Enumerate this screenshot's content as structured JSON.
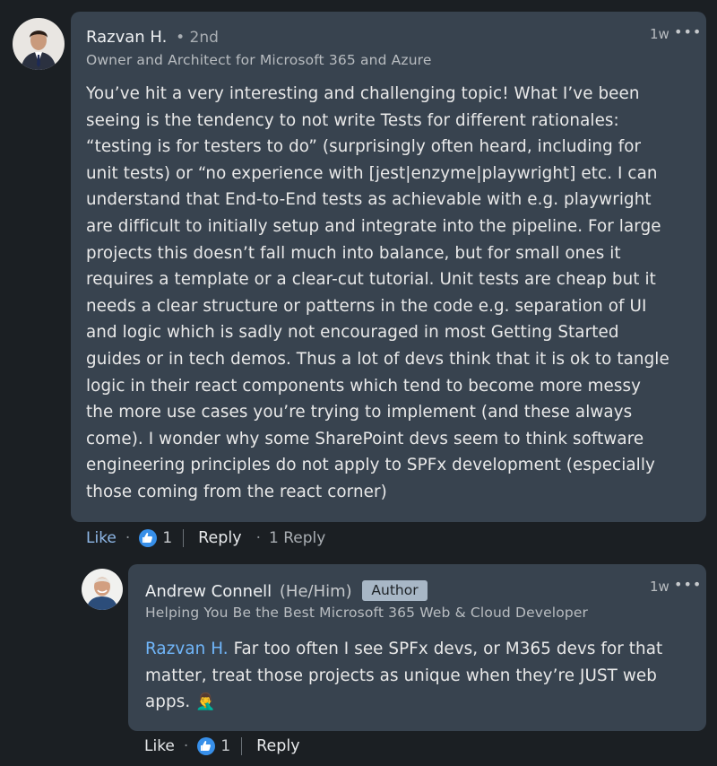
{
  "comment": {
    "author_name": "Razvan H.",
    "degree": "• 2nd",
    "headline": "Owner and Architect for Microsoft 365 and Azure",
    "time": "1w",
    "more": "•••",
    "lines": [
      "You’ve hit a very interesting and challenging topic! What I’ve been",
      "seeing is the tendency to not write Tests for different rationales:",
      "“testing is for testers to do” (surprisingly often heard, including for",
      "unit tests) or “no experience with [jest|enzyme|playwright] etc. I can",
      "understand that End-to-End tests as achievable with e.g. playwright",
      "are difficult to initially setup and integrate into the pipeline. For large",
      "projects this doesn’t fall much into balance, but for small ones it",
      "requires a template or a clear-cut tutorial. Unit tests are cheap but it",
      "needs a clear structure or patterns in the code e.g. separation of UI",
      "and logic which is sadly not encouraged in most Getting Started",
      "guides or in tech demos. Thus a lot of devs think that it is ok to tangle",
      "logic in their react components which tend to become more messy",
      "the more use cases you’re trying to implement (and these always",
      "come). I wonder why some SharePoint devs seem to think software",
      "engineering principles do not apply to SPFx development (especially",
      "those coming from the react corner)"
    ],
    "actions": {
      "like": "Like",
      "dot": "·",
      "reaction_count": "1",
      "reply": "Reply",
      "replies": "1 Reply"
    }
  },
  "reply": {
    "author_name": "Andrew Connell",
    "pronouns": "(He/Him)",
    "badge": "Author",
    "headline": "Helping You Be the Best Microsoft 365 Web & Cloud Developer",
    "time": "1w",
    "more": "•••",
    "mention": "Razvan H.",
    "line1_rest": " Far too often I see SPFx devs, or M365 devs for that",
    "line2": "matter, treat those projects as unique when they’re JUST web",
    "line3": "apps.",
    "emoji": "🤦‍♂️",
    "actions": {
      "like": "Like",
      "dot": "·",
      "reaction_count": "1",
      "reply": "Reply"
    }
  },
  "colors": {
    "background": "#1b1f23",
    "bubble": "#38434f",
    "link": "#71b7fb",
    "like": "#8fb8e8",
    "reaction": "#378fe9",
    "badge": "#a8b7c6"
  },
  "icons": [
    "thumbs-up-reaction-icon",
    "more-options-icon",
    "facepalm-emoji"
  ]
}
